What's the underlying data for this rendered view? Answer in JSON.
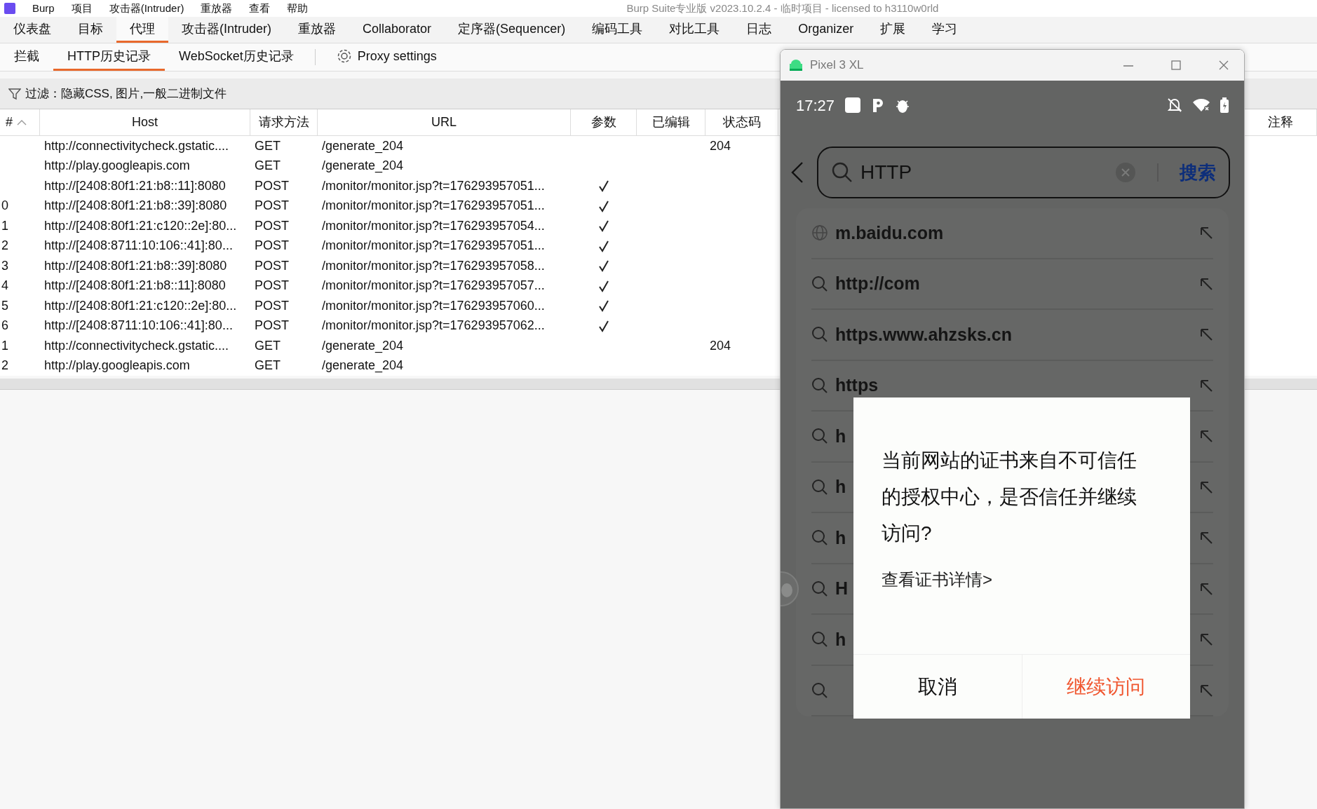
{
  "menu_bar": {
    "items": [
      "Burp",
      "项目",
      "攻击器(Intruder)",
      "重放器",
      "查看",
      "帮助"
    ],
    "title": "Burp Suite专业版 v2023.10.2.4 - 临时项目 - licensed to h3110w0rld"
  },
  "main_tabs": [
    {
      "label": "仪表盘",
      "selected": false
    },
    {
      "label": "目标",
      "selected": false
    },
    {
      "label": "代理",
      "selected": true
    },
    {
      "label": "攻击器(Intruder)",
      "selected": false
    },
    {
      "label": "重放器",
      "selected": false
    },
    {
      "label": "Collaborator",
      "selected": false
    },
    {
      "label": "定序器(Sequencer)",
      "selected": false
    },
    {
      "label": "编码工具",
      "selected": false
    },
    {
      "label": "对比工具",
      "selected": false
    },
    {
      "label": "日志",
      "selected": false
    },
    {
      "label": "Organizer",
      "selected": false
    },
    {
      "label": "扩展",
      "selected": false
    },
    {
      "label": "学习",
      "selected": false
    }
  ],
  "sub_tabs": [
    {
      "label": "拦截",
      "selected": false,
      "kind": "tab"
    },
    {
      "label": "HTTP历史记录",
      "selected": true,
      "kind": "tab"
    },
    {
      "label": "WebSocket历史记录",
      "selected": false,
      "kind": "tab"
    },
    {
      "label": "Proxy settings",
      "selected": false,
      "kind": "settings"
    }
  ],
  "filter": {
    "label": "过滤：隐藏CSS, 图片,一般二进制文件"
  },
  "table": {
    "columns": [
      "#",
      "Host",
      "请求方法",
      "URL",
      "参数",
      "已编辑",
      "状态码",
      "注释"
    ],
    "rows": [
      {
        "host": "http://connectivitycheck.gstatic....",
        "method": "GET",
        "url": "/generate_204",
        "params": false,
        "status": "204"
      },
      {
        "host": "http://play.googleapis.com",
        "method": "GET",
        "url": "/generate_204",
        "params": false
      },
      {
        "host": "http://[2408:80f1:21:b8::11]:8080",
        "method": "POST",
        "url": "/monitor/monitor.jsp?t=176293957051...",
        "params": true
      },
      {
        "number": "0",
        "host": "http://[2408:80f1:21:b8::39]:8080",
        "method": "POST",
        "url": "/monitor/monitor.jsp?t=176293957051...",
        "params": true
      },
      {
        "number": "1",
        "host": "http://[2408:80f1:21:c120::2e]:80...",
        "method": "POST",
        "url": "/monitor/monitor.jsp?t=176293957054...",
        "params": true
      },
      {
        "number": "2",
        "host": "http://[2408:8711:10:106::41]:80...",
        "method": "POST",
        "url": "/monitor/monitor.jsp?t=176293957051...",
        "params": true
      },
      {
        "number": "3",
        "host": "http://[2408:80f1:21:b8::39]:8080",
        "method": "POST",
        "url": "/monitor/monitor.jsp?t=176293957058...",
        "params": true
      },
      {
        "number": "4",
        "host": "http://[2408:80f1:21:b8::11]:8080",
        "method": "POST",
        "url": "/monitor/monitor.jsp?t=176293957057...",
        "params": true
      },
      {
        "number": "5",
        "host": "http://[2408:80f1:21:c120::2e]:80...",
        "method": "POST",
        "url": "/monitor/monitor.jsp?t=176293957060...",
        "params": true
      },
      {
        "number": "6",
        "host": "http://[2408:8711:10:106::41]:80...",
        "method": "POST",
        "url": "/monitor/monitor.jsp?t=176293957062...",
        "params": true
      },
      {
        "number": "1",
        "host": "http://connectivitycheck.gstatic....",
        "method": "GET",
        "url": "/generate_204",
        "params": false,
        "status": "204"
      },
      {
        "number": "2",
        "host": "http://play.googleapis.com",
        "method": "GET",
        "url": "/generate_204",
        "params": false
      }
    ]
  },
  "phone": {
    "title": "Pixel 3 XL",
    "time": "17:27",
    "search": {
      "value": "HTTP",
      "button": "搜索"
    },
    "suggestions": [
      {
        "kind": "site",
        "text": "m.baidu.com"
      },
      {
        "kind": "search",
        "text": "http://com"
      },
      {
        "kind": "search",
        "text": "https.www.ahzsks.cn"
      },
      {
        "kind": "search",
        "text": "https"
      },
      {
        "kind": "search",
        "text": "h"
      },
      {
        "kind": "search",
        "text": "h"
      },
      {
        "kind": "search",
        "text": "h"
      },
      {
        "kind": "search",
        "text": "H"
      },
      {
        "kind": "search",
        "text": "h"
      },
      {
        "kind": "search"
      }
    ],
    "dialog": {
      "message": "当前网站的证书来自不可信任的授权中心，是否信任并继续访问?",
      "link": "查看证书详情>",
      "buttons": [
        {
          "label": "取消",
          "kind": "cancel"
        },
        {
          "label": "继续访问",
          "kind": "confirm"
        }
      ]
    }
  }
}
